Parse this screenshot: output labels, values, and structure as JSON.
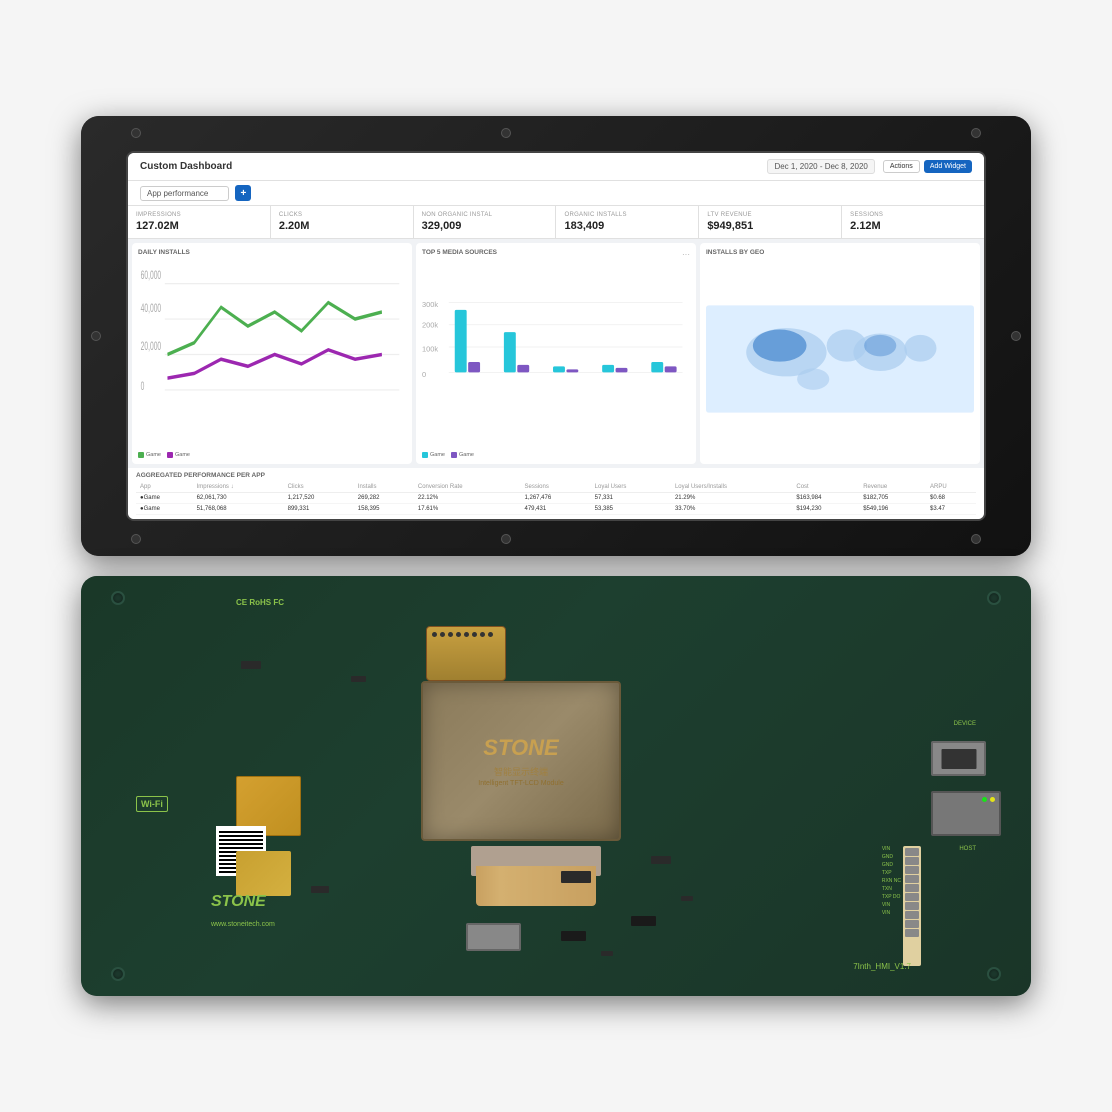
{
  "page": {
    "background": "#f5f5f5"
  },
  "dashboard": {
    "title": "Custom Dashboard",
    "date_range": "Dec 1, 2020 - Dec 8, 2020",
    "dropdown_label": "App performance",
    "btn_actions": "Actions",
    "btn_widget": "Add Widget",
    "kpis": [
      {
        "label": "IMPRESSIONS",
        "value": "127.02M"
      },
      {
        "label": "CLICKS",
        "value": "2.20M"
      },
      {
        "label": "NON ORGANIC INSTAL",
        "value": "329,009"
      },
      {
        "label": "ORGANIC INSTALLS",
        "value": "183,409"
      },
      {
        "label": "LTV REVENUE",
        "value": "$949,851"
      },
      {
        "label": "SESSIONS",
        "value": "2.12M"
      }
    ],
    "charts": {
      "daily_installs": {
        "title": "DAILY INSTALLS"
      },
      "top5_media": {
        "title": "TOP 5 MEDIA SOURCES"
      },
      "installs_geo": {
        "title": "INSTALLS BY GEO"
      }
    },
    "table": {
      "title": "AGGREGATED PERFORMANCE PER APP",
      "headers": [
        "App",
        "Impressions ↓",
        "Clicks",
        "Installs",
        "Conversion Rate",
        "Sessions",
        "Loyal Users",
        "Loyal Users/Installs",
        "Cost",
        "Revenue",
        "ARPU"
      ],
      "rows": [
        {
          "app": "●Game",
          "impressions": "62,061,730",
          "clicks": "1,217,520",
          "installs": "269,282",
          "conv": "22.12%",
          "sessions": "1,267,476",
          "loyal": "57,331",
          "loyal_rate": "21.29%",
          "cost": "$163,984",
          "revenue": "$182,705",
          "arpu": "$0.68"
        },
        {
          "app": "●Game",
          "impressions": "51,768,068",
          "clicks": "899,331",
          "installs": "158,395",
          "conv": "17.61%",
          "sessions": "479,431",
          "loyal": "53,385",
          "loyal_rate": "33.70%",
          "cost": "$194,230",
          "revenue": "$549,196",
          "arpu": "$3.47"
        }
      ]
    }
  },
  "pcb": {
    "chip_brand": "STONE",
    "chip_chinese": "智能显示终端",
    "chip_subtitle": "Intelligent TFT-LCD Module",
    "brand_bottom": "STONE",
    "website": "www.stoneitech.com",
    "version": "7Inth_HMI_V1.7",
    "wifi_label": "Wi-Fi",
    "certifications": "CE RoHS FC",
    "device_label": "DEVICE",
    "host_label": "HOST"
  }
}
